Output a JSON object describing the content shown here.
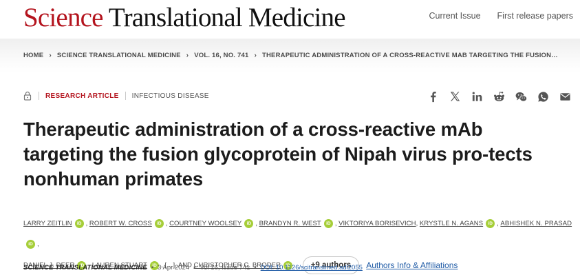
{
  "header": {
    "logo_science": "Science",
    "logo_rest": "Translational Medicine",
    "nav": [
      "Current Issue",
      "First release papers"
    ]
  },
  "breadcrumb": [
    "HOME",
    "SCIENCE TRANSLATIONAL MEDICINE",
    "VOL. 16, NO. 741",
    "THERAPEUTIC ADMINISTRATION OF A CROSS-REACTIVE MAB TARGETING THE FUSION…"
  ],
  "meta": {
    "article_type": "RESEARCH ARTICLE",
    "subject": "INFECTIOUS DISEASE"
  },
  "share_icons": [
    "facebook-icon",
    "x-icon",
    "linkedin-icon",
    "reddit-icon",
    "wechat-icon",
    "whatsapp-icon",
    "email-icon"
  ],
  "title": "Therapeutic administration of a cross-reactive mAb targeting the fusion glycoprotein of Nipah virus pro-tects nonhuman primates",
  "authors": {
    "names": [
      "Larry Zeitlin",
      "Robert W. Cross",
      "Courtney Woolsey",
      "Brandyn R. West",
      "Viktoriya Borisevich",
      "Krystle N. Agans",
      "Abhishek N. Prasad",
      "Daniel J. Deer",
      "Lauren Stuart",
      "Christopher C. Broder"
    ],
    "ellipsis": "[…]",
    "and": "AND",
    "more_label": "+9 authors",
    "affiliations_label": "Authors Info & Affiliations",
    "orcid_label": "iD"
  },
  "citation": {
    "journal": "SCIENCE TRANSLATIONAL MEDICINE",
    "date": "3 Apr 2024",
    "volume": "Vol 16, Issue 741",
    "doi": "DOI: 10.1126/scitranslmed.adl2055"
  },
  "colors": {
    "brand_red": "#b4141e",
    "link_blue": "#1f5ba6",
    "orcid_green": "#a6ce39"
  }
}
